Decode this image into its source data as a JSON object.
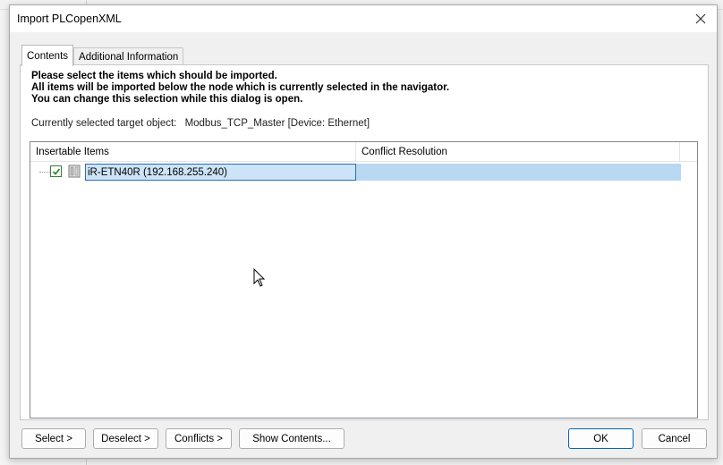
{
  "dialog": {
    "title": "Import PLCopenXML",
    "close_icon": "close-icon"
  },
  "tabs": [
    {
      "label": "Contents",
      "active": true
    },
    {
      "label": "Additional Information",
      "active": false
    }
  ],
  "instructions": {
    "line1": "Please select the items which should be imported.",
    "line2": "All items will be imported below the node which is currently selected in the navigator.",
    "line3": "You can change this selection while this dialog is open."
  },
  "target": {
    "label": "Currently selected target object:",
    "value": "Modbus_TCP_Master [Device: Ethernet]"
  },
  "grid": {
    "columns": [
      "Insertable Items",
      "Conflict Resolution"
    ],
    "rows": [
      {
        "checked": true,
        "icon": "device-icon",
        "item": "iR-ETN40R (192.168.255.240)",
        "conflict": ""
      }
    ]
  },
  "buttons": {
    "select": "Select >",
    "deselect": "Deselect >",
    "conflicts": "Conflicts >",
    "show_contents": "Show Contents...",
    "ok": "OK",
    "cancel": "Cancel"
  },
  "colors": {
    "selection": "#b9d8f2",
    "selection_border": "#2a6cc4",
    "primary_border": "#0067c0"
  }
}
